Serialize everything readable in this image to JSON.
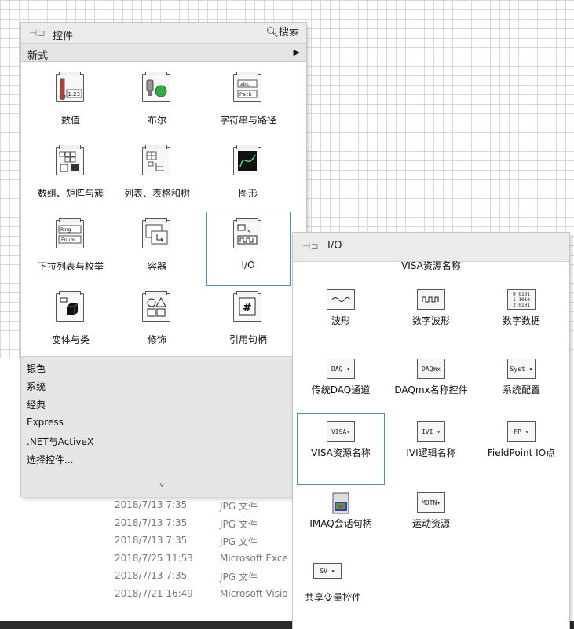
{
  "controls_palette": {
    "title": "控件",
    "search_label": "搜索",
    "subcategory": "新式",
    "items": [
      {
        "label": "数值",
        "icon": "numeric-icon"
      },
      {
        "label": "布尔",
        "icon": "boolean-icon"
      },
      {
        "label": "字符串与路径",
        "icon": "string-path-icon"
      },
      {
        "label": "数组、矩阵与簇",
        "icon": "array-matrix-cluster-icon"
      },
      {
        "label": "列表、表格和树",
        "icon": "list-table-tree-icon"
      },
      {
        "label": "图形",
        "icon": "graph-icon"
      },
      {
        "label": "下拉列表与枚举",
        "icon": "ring-enum-icon"
      },
      {
        "label": "容器",
        "icon": "container-icon"
      },
      {
        "label": "I/O",
        "icon": "io-icon",
        "selected": true
      },
      {
        "label": "变体与类",
        "icon": "variant-class-icon"
      },
      {
        "label": "修饰",
        "icon": "decoration-icon"
      },
      {
        "label": "引用句柄",
        "icon": "refnum-icon"
      }
    ],
    "number_label": "1.23",
    "string_labels": [
      "abc",
      "Path"
    ],
    "ring_labels": [
      "Ring",
      "Enum"
    ],
    "refnum_symbol": "#",
    "categories": [
      "银色",
      "系统",
      "经典",
      "Express",
      ".NET与ActiveX",
      "选择控件..."
    ],
    "more_symbol": "»"
  },
  "io_palette": {
    "title": "I/O",
    "hover_label": "VISA资源名称",
    "items": [
      {
        "label": "波形",
        "tag": "~"
      },
      {
        "label": "数字波形",
        "tag": "ᴨᴨ"
      },
      {
        "label": "数字数据",
        "tag": "0 0101"
      },
      {
        "label": "传统DAQ通道",
        "tag": "DAQ ▾"
      },
      {
        "label": "DAQmx名称控件",
        "tag": "DAQmx"
      },
      {
        "label": "系统配置",
        "tag": "Syst ▾"
      },
      {
        "label": "VISA资源名称",
        "tag": "VISA▾",
        "selected": true
      },
      {
        "label": "IVI逻辑名称",
        "tag": "IVI ▾"
      },
      {
        "label": "FieldPoint IO点",
        "tag": "FP ▾"
      },
      {
        "label": "IMAQ会话句柄",
        "tag": ""
      },
      {
        "label": "运动资源",
        "tag": "MOTN▾"
      },
      {
        "label": "共享变量控件",
        "tag": "SV ▾"
      }
    ]
  },
  "background_files": [
    {
      "date": "2018/7/13 7:35",
      "type": "JPG 文件"
    },
    {
      "date": "2018/7/13 7:35",
      "type": "JPG 文件"
    },
    {
      "date": "2018/7/13 7:35",
      "type": "JPG 文件"
    },
    {
      "date": "2018/7/25 11:53",
      "type": "Microsoft Exce"
    },
    {
      "date": "2018/7/13 7:35",
      "type": "JPG 文件"
    },
    {
      "date": "2018/7/21 16:49",
      "type": "Microsoft Visio"
    }
  ]
}
